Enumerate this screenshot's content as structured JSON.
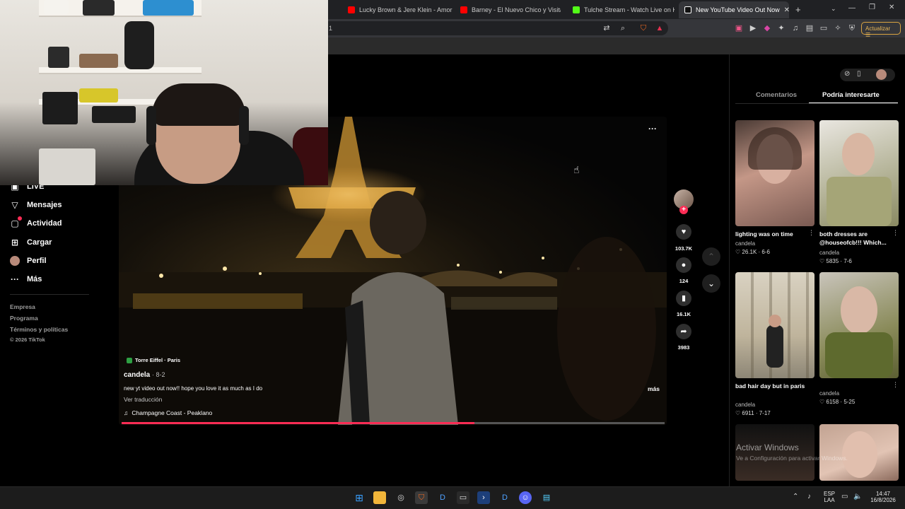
{
  "browser": {
    "tabs": [
      {
        "title": "Lucky Brown & Jere Klein - Amor Ex",
        "favicon_color": "#ff0000"
      },
      {
        "title": "Barney - El Nuevo Chico y Visita",
        "favicon_color": "#ff0000"
      },
      {
        "title": "Tulche Stream - Watch Live on Kick",
        "favicon_color": "#53fc18"
      },
      {
        "title": "New YouTube Video Out Now",
        "favicon_color": "#ffffff"
      }
    ],
    "url_fragment": "1",
    "update_label": "Actualizar"
  },
  "sidebar": {
    "items": [
      {
        "label": "LIVE",
        "icon": "live-icon"
      },
      {
        "label": "Mensajes",
        "icon": "send-icon"
      },
      {
        "label": "Actividad",
        "icon": "activity-icon"
      },
      {
        "label": "Cargar",
        "icon": "upload-icon"
      },
      {
        "label": "Perfil",
        "icon": "avatar-icon"
      },
      {
        "label": "Más",
        "icon": "more-icon"
      }
    ],
    "footer": [
      "Empresa",
      "Programa",
      "Términos y políticas",
      "© 2026 TikTok"
    ]
  },
  "video": {
    "location": "Torre Eiffel · Paris",
    "author": "candela",
    "date": "8-2",
    "caption": "new yt video out now!! hope you love it as much as I do",
    "more_label": "más",
    "translate_label": "Ver traducción",
    "music": "Champagne Coast - Peaklano",
    "progress": 0.65,
    "likes": "103.7K",
    "comments": "124",
    "saves": "16.1K",
    "shares": "3983"
  },
  "right_panel": {
    "tabs": [
      "Comentarios",
      "Podría interesarte"
    ],
    "active_tab": "Podría interesarte",
    "cards": [
      {
        "title": "lighting was on time",
        "author": "candela",
        "likes": "26.1K",
        "date": "6-6"
      },
      {
        "title": "both dresses are @houseofcb!!! Which...",
        "author": "candela",
        "likes": "5835",
        "date": "7-6"
      },
      {
        "title": "bad hair day but in paris",
        "author": "candela",
        "likes": "6911",
        "date": "7-17"
      },
      {
        "title": "",
        "author": "candela",
        "likes": "6158",
        "date": "5-25"
      }
    ]
  },
  "windows": {
    "watermark_title": "Activar Windows",
    "watermark_sub": "Ve a Configuración para activar Windows.",
    "lang_top": "ESP",
    "lang_bottom": "LAA",
    "time": "14:47",
    "date": "16/8/2026"
  }
}
